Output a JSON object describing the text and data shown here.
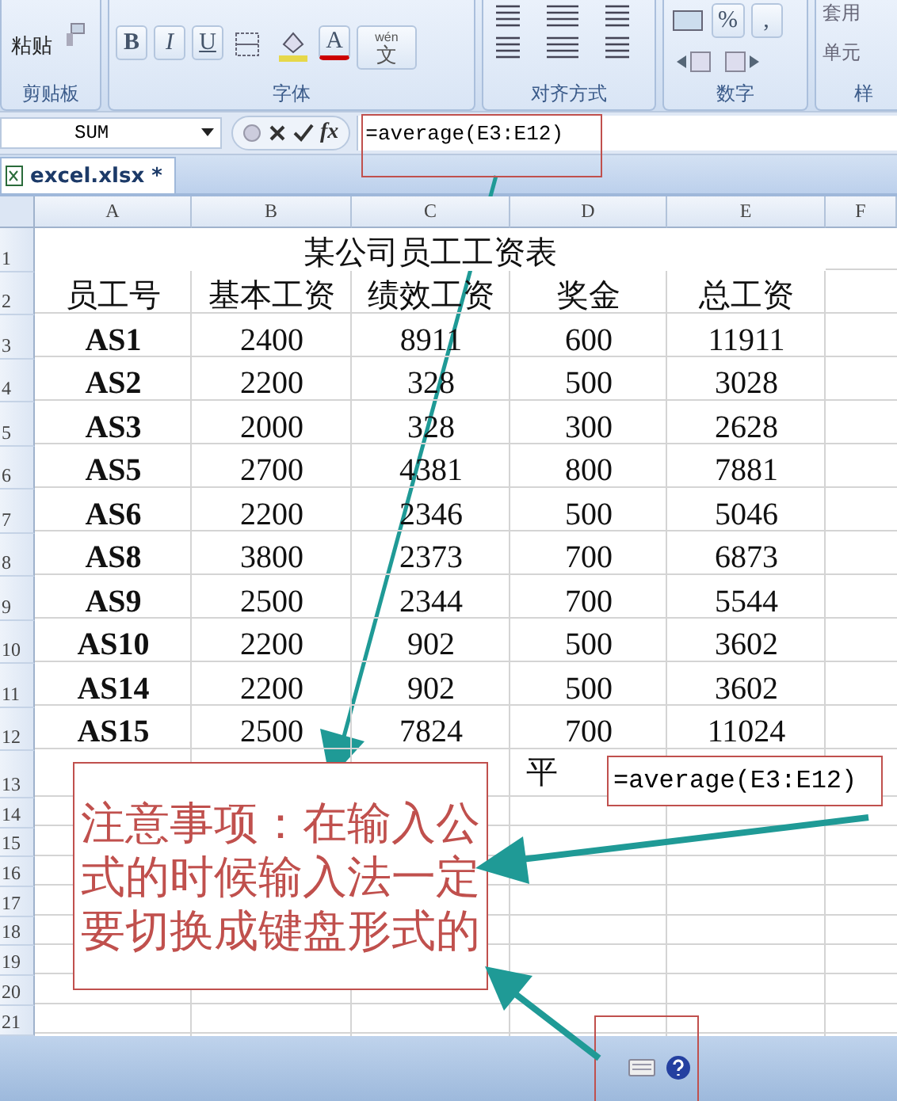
{
  "ribbon": {
    "groups": [
      {
        "kind": "clipboard",
        "label": "剪贴板",
        "paste": "粘贴"
      },
      {
        "kind": "font",
        "label": "字体",
        "buttons": [
          "B",
          "I",
          "U"
        ],
        "font_color": "A",
        "phonetic": [
          "wén",
          "文"
        ]
      },
      {
        "kind": "alignment",
        "label": "对齐方式"
      },
      {
        "kind": "number",
        "label": "数字",
        "buttons": [
          "%",
          ","
        ]
      },
      {
        "kind": "styles",
        "label": "样",
        "items": [
          "套用",
          "单元"
        ]
      }
    ]
  },
  "formula_bar": {
    "name_box": "SUM",
    "function_label": "fx",
    "formula": "=average(E3:E12)"
  },
  "sheet_tabs": [
    {
      "label": "excel.xlsx *",
      "selected": true
    }
  ],
  "sheet": {
    "columns": [
      "A",
      "B",
      "C",
      "D",
      "E",
      "F"
    ],
    "row_numbers": [
      "1",
      "2",
      "3",
      "4",
      "5",
      "6",
      "7",
      "8",
      "9",
      "10",
      "11",
      "12",
      "13",
      "14",
      "15",
      "16",
      "17",
      "18",
      "19",
      "20",
      "21"
    ],
    "title": "某公司员工工资表",
    "headers": [
      "员工号",
      "基本工资",
      "绩效工资",
      "奖金",
      "总工资"
    ],
    "rows": [
      [
        "AS1",
        "2400",
        "8911",
        "600",
        "11911"
      ],
      [
        "AS2",
        "2200",
        "328",
        "500",
        "3028"
      ],
      [
        "AS3",
        "2000",
        "328",
        "300",
        "2628"
      ],
      [
        "AS5",
        "2700",
        "4381",
        "800",
        "7881"
      ],
      [
        "AS6",
        "2200",
        "2346",
        "500",
        "5046"
      ],
      [
        "AS8",
        "3800",
        "2373",
        "700",
        "6873"
      ],
      [
        "AS9",
        "2500",
        "2344",
        "700",
        "5544"
      ],
      [
        "AS10",
        "2200",
        "902",
        "500",
        "3602"
      ],
      [
        "AS14",
        "2200",
        "902",
        "500",
        "3602"
      ],
      [
        "AS15",
        "2500",
        "7824",
        "700",
        "11024"
      ]
    ],
    "summary": {
      "label": "平",
      "formula": "=average(E3:E12)"
    }
  },
  "annotation": {
    "note": "注意事项：在输入公式的时候输入法一定要切换成键盘形式的"
  }
}
